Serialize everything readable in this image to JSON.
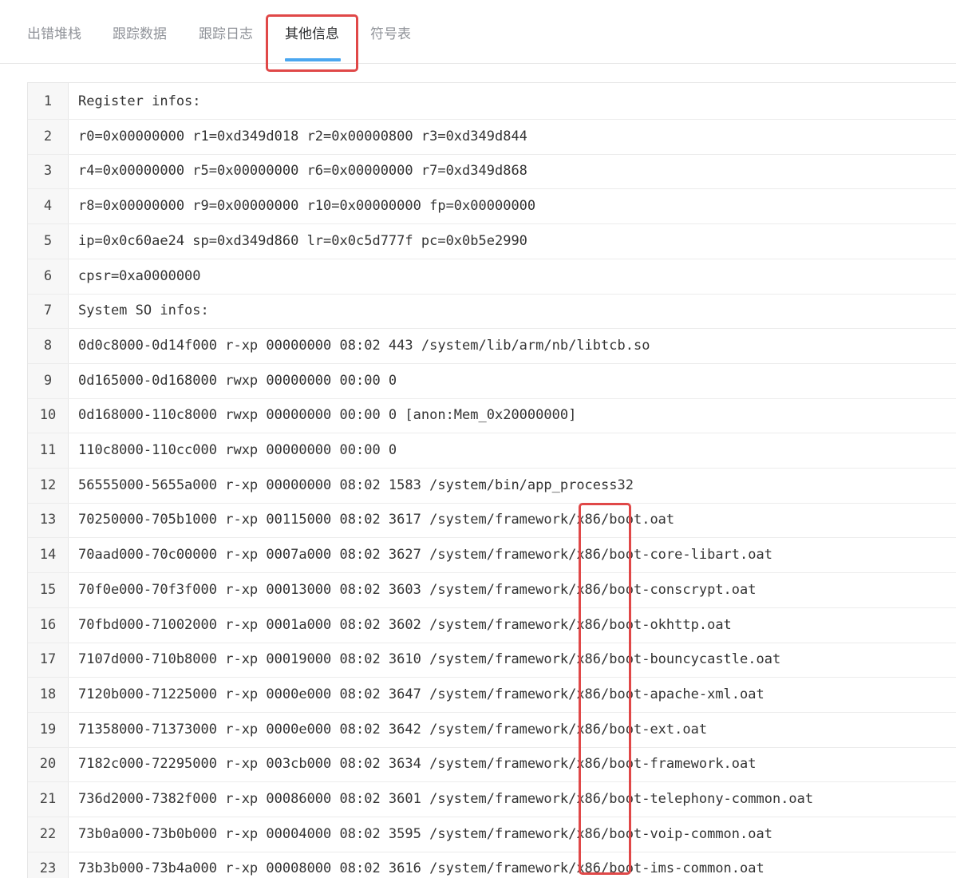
{
  "tabs": [
    {
      "label": "出错堆栈",
      "active": false
    },
    {
      "label": "跟踪数据",
      "active": false
    },
    {
      "label": "跟踪日志",
      "active": false
    },
    {
      "label": "其他信息",
      "active": true
    },
    {
      "label": "符号表",
      "active": false
    }
  ],
  "colors": {
    "highlight": "#e04848",
    "tab_underline": "#4aa7f0"
  },
  "code_lines": [
    {
      "no": "1",
      "text": "Register infos:"
    },
    {
      "no": "2",
      "text": "r0=0x00000000 r1=0xd349d018 r2=0x00000800 r3=0xd349d844"
    },
    {
      "no": "3",
      "text": "r4=0x00000000 r5=0x00000000 r6=0x00000000 r7=0xd349d868"
    },
    {
      "no": "4",
      "text": "r8=0x00000000 r9=0x00000000 r10=0x00000000 fp=0x00000000"
    },
    {
      "no": "5",
      "text": "ip=0x0c60ae24 sp=0xd349d860 lr=0x0c5d777f pc=0x0b5e2990"
    },
    {
      "no": "6",
      "text": "cpsr=0xa0000000"
    },
    {
      "no": "7",
      "text": "System SO infos:"
    },
    {
      "no": "8",
      "text": "0d0c8000-0d14f000 r-xp 00000000 08:02 443 /system/lib/arm/nb/libtcb.so"
    },
    {
      "no": "9",
      "text": "0d165000-0d168000 rwxp 00000000 00:00 0"
    },
    {
      "no": "10",
      "text": "0d168000-110c8000 rwxp 00000000 00:00 0 [anon:Mem_0x20000000]"
    },
    {
      "no": "11",
      "text": "110c8000-110cc000 rwxp 00000000 00:00 0"
    },
    {
      "no": "12",
      "text": "56555000-5655a000 r-xp 00000000 08:02 1583 /system/bin/app_process32"
    },
    {
      "no": "13",
      "text": "70250000-705b1000 r-xp 00115000 08:02 3617 /system/framework/x86/boot.oat"
    },
    {
      "no": "14",
      "text": "70aad000-70c00000 r-xp 0007a000 08:02 3627 /system/framework/x86/boot-core-libart.oat"
    },
    {
      "no": "15",
      "text": "70f0e000-70f3f000 r-xp 00013000 08:02 3603 /system/framework/x86/boot-conscrypt.oat"
    },
    {
      "no": "16",
      "text": "70fbd000-71002000 r-xp 0001a000 08:02 3602 /system/framework/x86/boot-okhttp.oat"
    },
    {
      "no": "17",
      "text": "7107d000-710b8000 r-xp 00019000 08:02 3610 /system/framework/x86/boot-bouncycastle.oat"
    },
    {
      "no": "18",
      "text": "7120b000-71225000 r-xp 0000e000 08:02 3647 /system/framework/x86/boot-apache-xml.oat"
    },
    {
      "no": "19",
      "text": "71358000-71373000 r-xp 0000e000 08:02 3642 /system/framework/x86/boot-ext.oat"
    },
    {
      "no": "20",
      "text": "7182c000-72295000 r-xp 003cb000 08:02 3634 /system/framework/x86/boot-framework.oat"
    },
    {
      "no": "21",
      "text": "736d2000-7382f000 r-xp 00086000 08:02 3601 /system/framework/x86/boot-telephony-common.oat"
    },
    {
      "no": "22",
      "text": "73b0a000-73b0b000 r-xp 00004000 08:02 3595 /system/framework/x86/boot-voip-common.oat"
    },
    {
      "no": "23",
      "text": "73b3b000-73b4a000 r-xp 00008000 08:02 3616 /system/framework/x86/boot-ims-common.oat"
    }
  ]
}
